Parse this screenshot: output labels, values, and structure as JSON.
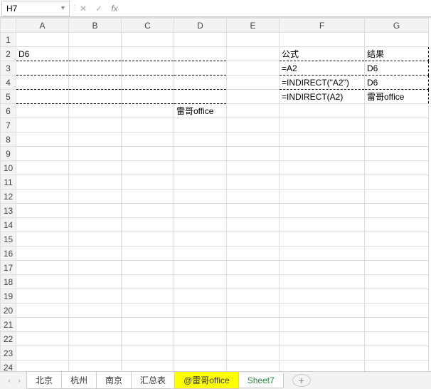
{
  "formula_bar": {
    "cell_ref": "H7",
    "formula_value": "",
    "fx_label": "fx"
  },
  "columns": [
    "A",
    "B",
    "C",
    "D",
    "E",
    "F",
    "G"
  ],
  "rows": [
    "1",
    "2",
    "3",
    "4",
    "5",
    "6",
    "7",
    "8",
    "9",
    "10",
    "11",
    "12",
    "13",
    "14",
    "15",
    "16",
    "17",
    "18",
    "19",
    "20",
    "21",
    "22",
    "23",
    "24"
  ],
  "cells": {
    "A2": "D6",
    "D6": "雷哥office",
    "F2": "公式",
    "G2": "结果",
    "F3": "=A2",
    "G3": "D6",
    "F4": "=INDIRECT(\"A2\")",
    "G4": "D6",
    "F5": "=INDIRECT(A2)",
    "G5": "雷哥office"
  },
  "tabs": {
    "items": [
      "北京",
      "杭州",
      "南京",
      "汇总表",
      "@雷哥office",
      "Sheet7"
    ],
    "active_index": 4,
    "green_index": 5
  },
  "icons": {
    "dropdown": "▾",
    "cancel": "✕",
    "accept": "✓",
    "nav_first": "«",
    "nav_prev": "‹",
    "nav_next": "›",
    "nav_last": "»",
    "plus": "+",
    "vdots": "⋮"
  }
}
